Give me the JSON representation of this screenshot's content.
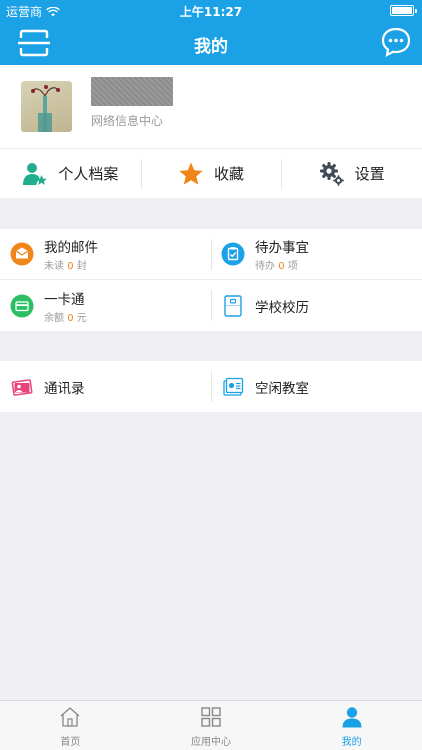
{
  "status": {
    "carrier": "运营商",
    "time": "上午11:27"
  },
  "nav": {
    "title": "我的"
  },
  "profile": {
    "org": "网络信息中心"
  },
  "actions": [
    {
      "label": "个人档案",
      "icon": "user-star-icon"
    },
    {
      "label": "收藏",
      "icon": "star-icon"
    },
    {
      "label": "设置",
      "icon": "gear-icon"
    }
  ],
  "group1": [
    {
      "label": "我的邮件",
      "sub_prefix": "未读",
      "count": "0",
      "sub_suffix": "封",
      "icon": "mail-icon",
      "color": "#f08519"
    },
    {
      "label": "待办事宜",
      "sub_prefix": "待办",
      "count": "0",
      "sub_suffix": "项",
      "icon": "clipboard-icon",
      "color": "#1aa1e6"
    },
    {
      "label": "一卡通",
      "sub_prefix": "余额",
      "count": "0",
      "sub_suffix": "元",
      "icon": "card-icon",
      "color": "#2dbf64"
    },
    {
      "label": "学校校历",
      "icon": "calendar-icon",
      "color": "#1aa1e6"
    }
  ],
  "group2": [
    {
      "label": "通讯录",
      "icon": "contacts-icon",
      "color": "#e8457a"
    },
    {
      "label": "空闲教室",
      "icon": "classroom-icon",
      "color": "#1aa1e6"
    }
  ],
  "tabs": [
    {
      "label": "首页",
      "icon": "home-icon"
    },
    {
      "label": "应用中心",
      "icon": "grid-icon"
    },
    {
      "label": "我的",
      "icon": "person-icon",
      "active": true
    }
  ],
  "colors": {
    "primary": "#1aa1e6",
    "highlight": "#f08519"
  }
}
